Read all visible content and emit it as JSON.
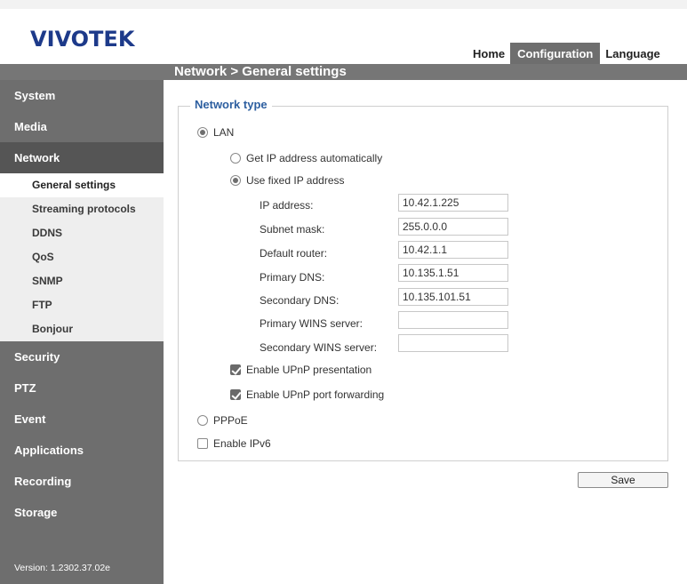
{
  "brand": {
    "logo": "VIVOTEK"
  },
  "topnav": {
    "home": "Home",
    "configuration": "Configuration",
    "language": "Language"
  },
  "page_title": "Network  > General settings",
  "sidebar": {
    "items": [
      {
        "label": "System"
      },
      {
        "label": "Media"
      },
      {
        "label": "Network"
      },
      {
        "label": "Security"
      },
      {
        "label": "PTZ"
      },
      {
        "label": "Event"
      },
      {
        "label": "Applications"
      },
      {
        "label": "Recording"
      },
      {
        "label": "Storage"
      }
    ],
    "network_sub": [
      {
        "label": "General settings"
      },
      {
        "label": "Streaming protocols"
      },
      {
        "label": "DDNS"
      },
      {
        "label": "QoS"
      },
      {
        "label": "SNMP"
      },
      {
        "label": "FTP"
      },
      {
        "label": "Bonjour"
      }
    ],
    "version": "Version: 1.2302.37.02e"
  },
  "form": {
    "legend": "Network type",
    "lan_label": "LAN",
    "get_ip_auto_label": "Get IP address automatically",
    "use_fixed_ip_label": "Use fixed IP address",
    "fields": {
      "ip_address": {
        "label": "IP address:",
        "value": "10.42.1.225"
      },
      "subnet_mask": {
        "label": "Subnet mask:",
        "value": "255.0.0.0"
      },
      "default_router": {
        "label": "Default router:",
        "value": "10.42.1.1"
      },
      "primary_dns": {
        "label": "Primary DNS:",
        "value": "10.135.1.51"
      },
      "secondary_dns": {
        "label": "Secondary DNS:",
        "value": "10.135.101.51"
      },
      "primary_wins": {
        "label": "Primary WINS server:",
        "value": ""
      },
      "secondary_wins": {
        "label": "Secondary WINS server:",
        "value": ""
      }
    },
    "upnp_presentation_label": "Enable UPnP presentation",
    "upnp_port_forwarding_label": "Enable UPnP port forwarding",
    "pppoe_label": "PPPoE",
    "ipv6_label": "Enable IPv6",
    "save_label": "Save"
  },
  "state": {
    "network_type": "LAN",
    "ip_mode": "fixed",
    "upnp_presentation": true,
    "upnp_port_forwarding": true,
    "ipv6": false
  },
  "colors": {
    "brand_blue": "#1d3a8a",
    "sidebar_gray": "#6e6e6e",
    "legend_blue": "#2d5fa0"
  }
}
